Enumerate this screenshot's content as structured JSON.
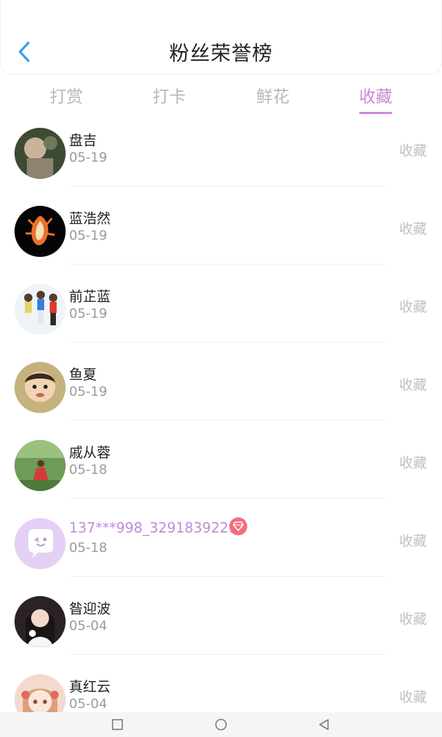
{
  "header": {
    "title": "粉丝荣誉榜"
  },
  "tabs": [
    {
      "label": "打赏",
      "active": false
    },
    {
      "label": "打卡",
      "active": false
    },
    {
      "label": "鲜花",
      "active": false
    },
    {
      "label": "收藏",
      "active": true
    }
  ],
  "colors": {
    "accent": "#c58ad8",
    "badge": "#f06f7d",
    "back": "#3aa0e8"
  },
  "list": [
    {
      "name": "盘吉",
      "date": "05-19",
      "action": "收藏",
      "avatar": "photo-dark-green"
    },
    {
      "name": "蓝浩然",
      "date": "05-19",
      "action": "收藏",
      "avatar": "photo-black-orange"
    },
    {
      "name": "前芷蓝",
      "date": "05-19",
      "action": "收藏",
      "avatar": "photo-three-kids"
    },
    {
      "name": "鱼夏",
      "date": "05-19",
      "action": "收藏",
      "avatar": "photo-child-face"
    },
    {
      "name": "戚从蓉",
      "date": "05-18",
      "action": "收藏",
      "avatar": "photo-green-field"
    },
    {
      "name": "137***998_3291839221",
      "date": "05-18",
      "action": "收藏",
      "avatar": "chat-bubble-icon",
      "badge": "diamond-icon"
    },
    {
      "name": "昝迎波",
      "date": "05-04",
      "action": "收藏",
      "avatar": "photo-woman-white"
    },
    {
      "name": "真红云",
      "date": "05-04",
      "action": "收藏",
      "avatar": "photo-anime-girl"
    }
  ],
  "navbar": [
    "square-icon",
    "circle-icon",
    "triangle-back-icon"
  ]
}
